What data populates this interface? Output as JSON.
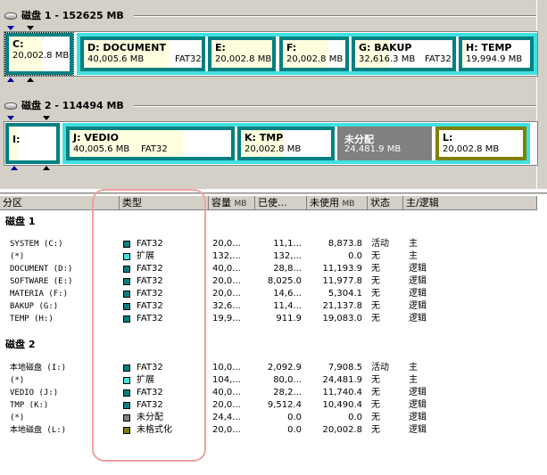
{
  "disk_map": {
    "disk1": {
      "title": "磁盘 1 - 152625 MB",
      "partitions": [
        {
          "name": "C:",
          "info": "20,002.8 MB",
          "fs": "",
          "kind": "primary",
          "fill": 0.55
        },
        {
          "name": "D:  DOCUMENT",
          "info": "40,005.6 MB",
          "fs": "FAT32",
          "kind": "logical",
          "fill": 0.72
        },
        {
          "name": "E:",
          "info": "20,002.8 MB",
          "fs": "",
          "kind": "logical",
          "fill": 1.0
        },
        {
          "name": "F:",
          "info": "20,002.8 MB",
          "fs": "",
          "kind": "logical",
          "fill": 0.73
        },
        {
          "name": "G:  BAKUP",
          "info": "32,616.3 MB",
          "fs": "FAT32",
          "kind": "logical",
          "fill": 0.35
        },
        {
          "name": "H:  TEMP",
          "info": "19,994.9 MB",
          "fs": "",
          "kind": "logical",
          "fill": 0.05
        }
      ]
    },
    "disk2": {
      "title": "磁盘 2 - 114494 MB",
      "partitions": [
        {
          "name": "I:",
          "info": "",
          "fs": "",
          "kind": "primary",
          "fill": 0.2
        },
        {
          "name": "J:  VEDIO",
          "info": "40,005.6 MB",
          "fs": "FAT32",
          "kind": "logical",
          "fill": 0.7
        },
        {
          "name": "K:  TMP",
          "info": "20,002.8 MB",
          "fs": "",
          "kind": "logical",
          "fill": 0.47
        },
        {
          "name": "未分配",
          "info": "24,481.9 MB",
          "fs": "",
          "kind": "unallocated",
          "fill": 0
        },
        {
          "name": "L:",
          "info": "20,002.8 MB",
          "fs": "",
          "kind": "unformatted",
          "fill": 0
        }
      ]
    }
  },
  "columns": {
    "partition": "分区",
    "type": "类型",
    "capacity": "容量",
    "capacity_unit": "MB",
    "used": "已使...",
    "unused": "未使用",
    "unused_unit": "MB",
    "status": "状态",
    "role": "主/逻辑"
  },
  "groups": [
    {
      "label": "磁盘 1",
      "rows": [
        {
          "name": "SYSTEM (C:)",
          "type": "FAT32",
          "color": "#008080",
          "capacity": "20,0...",
          "used": "11,1...",
          "unused": "8,873.8",
          "status": "活动",
          "role": "主"
        },
        {
          "name": "(*)",
          "type": "扩展",
          "color": "#40e0e0",
          "capacity": "132,...",
          "used": "132,...",
          "unused": "0.0",
          "status": "无",
          "role": "主"
        },
        {
          "name": "DOCUMENT (D:)",
          "type": "FAT32",
          "color": "#008080",
          "capacity": "40,0...",
          "used": "28,8...",
          "unused": "11,193.9",
          "status": "无",
          "role": "逻辑"
        },
        {
          "name": "SOFTWARE (E:)",
          "type": "FAT32",
          "color": "#008080",
          "capacity": "20,0...",
          "used": "8,025.0",
          "unused": "11,977.8",
          "status": "无",
          "role": "逻辑"
        },
        {
          "name": "MATERIA (F:)",
          "type": "FAT32",
          "color": "#008080",
          "capacity": "20,0...",
          "used": "14,6...",
          "unused": "5,304.1",
          "status": "无",
          "role": "逻辑"
        },
        {
          "name": "BAKUP (G:)",
          "type": "FAT32",
          "color": "#008080",
          "capacity": "32,6...",
          "used": "11,4...",
          "unused": "21,137.8",
          "status": "无",
          "role": "逻辑"
        },
        {
          "name": "TEMP (H:)",
          "type": "FAT32",
          "color": "#008080",
          "capacity": "19,9...",
          "used": "911.9",
          "unused": "19,083.0",
          "status": "无",
          "role": "逻辑"
        }
      ]
    },
    {
      "label": "磁盘 2",
      "rows": [
        {
          "name": "本地磁盘 (I:)",
          "type": "FAT32",
          "color": "#008080",
          "capacity": "10,0...",
          "used": "2,092.9",
          "unused": "7,908.5",
          "status": "活动",
          "role": "主"
        },
        {
          "name": "(*)",
          "type": "扩展",
          "color": "#40e0e0",
          "capacity": "104,...",
          "used": "80,0...",
          "unused": "24,481.9",
          "status": "无",
          "role": "主"
        },
        {
          "name": "VEDIO (J:)",
          "type": "FAT32",
          "color": "#008080",
          "capacity": "40,0...",
          "used": "28,2...",
          "unused": "11,740.4",
          "status": "无",
          "role": "逻辑"
        },
        {
          "name": "TMP (K:)",
          "type": "FAT32",
          "color": "#008080",
          "capacity": "20,0...",
          "used": "9,512.4",
          "unused": "10,490.4",
          "status": "无",
          "role": "逻辑"
        },
        {
          "name": "(*)",
          "type": "未分配",
          "color": "#808080",
          "capacity": "24,4...",
          "used": "0.0",
          "unused": "0.0",
          "status": "无",
          "role": "逻辑"
        },
        {
          "name": "本地磁盘 (L:)",
          "type": "未格式化",
          "color": "#808000",
          "capacity": "20,0...",
          "used": "0.0",
          "unused": "20,002.8",
          "status": "无",
          "role": "逻辑"
        }
      ]
    }
  ],
  "colors": {
    "fat32": "#008080",
    "extended": "#40e0e0",
    "unallocated": "#808080",
    "unformatted": "#808000",
    "used_fill": "#ffffe0",
    "annotation": "#f0a0a0"
  }
}
